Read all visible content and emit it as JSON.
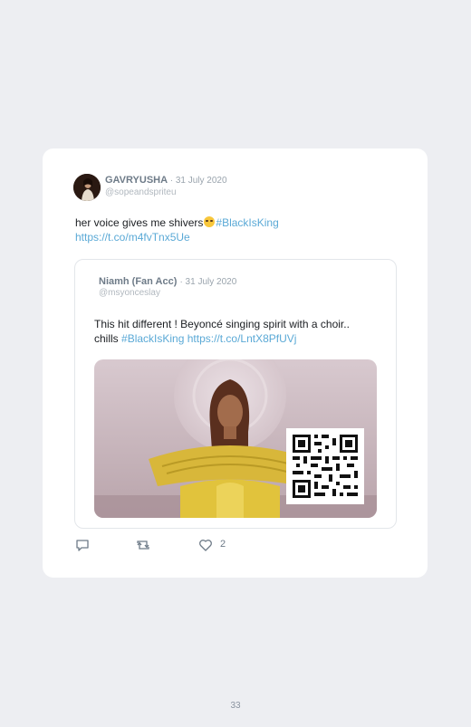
{
  "tweet": {
    "author": "GAVRYUSHA",
    "date": "· 31 July 2020",
    "handle": "@sopeandspriteu",
    "text_before": "her voice gives me shivers",
    "hashtag": "#BlackIsKing",
    "link": "https://t.co/m4fvTnx5Ue",
    "like_count": "2"
  },
  "quoted": {
    "author": "Niamh (Fan Acc)",
    "date": "· 31 July 2020",
    "handle": "@msyonceslay",
    "text": "This hit different ! Beyoncé singing spirit with a choir.. chills",
    "hashtag": "#BlackIsKing",
    "link": "https://t.co/LntX8PfUVj"
  },
  "page": {
    "number": "33"
  },
  "icons": {
    "reply": "reply-icon",
    "retweet": "retweet-icon",
    "like": "heart-icon",
    "emoji": "smiling-emoji-icon",
    "qr": "qr-code-icon"
  },
  "colors": {
    "link": "#5aa9d6",
    "background": "#edeef2",
    "card": "#ffffff"
  }
}
